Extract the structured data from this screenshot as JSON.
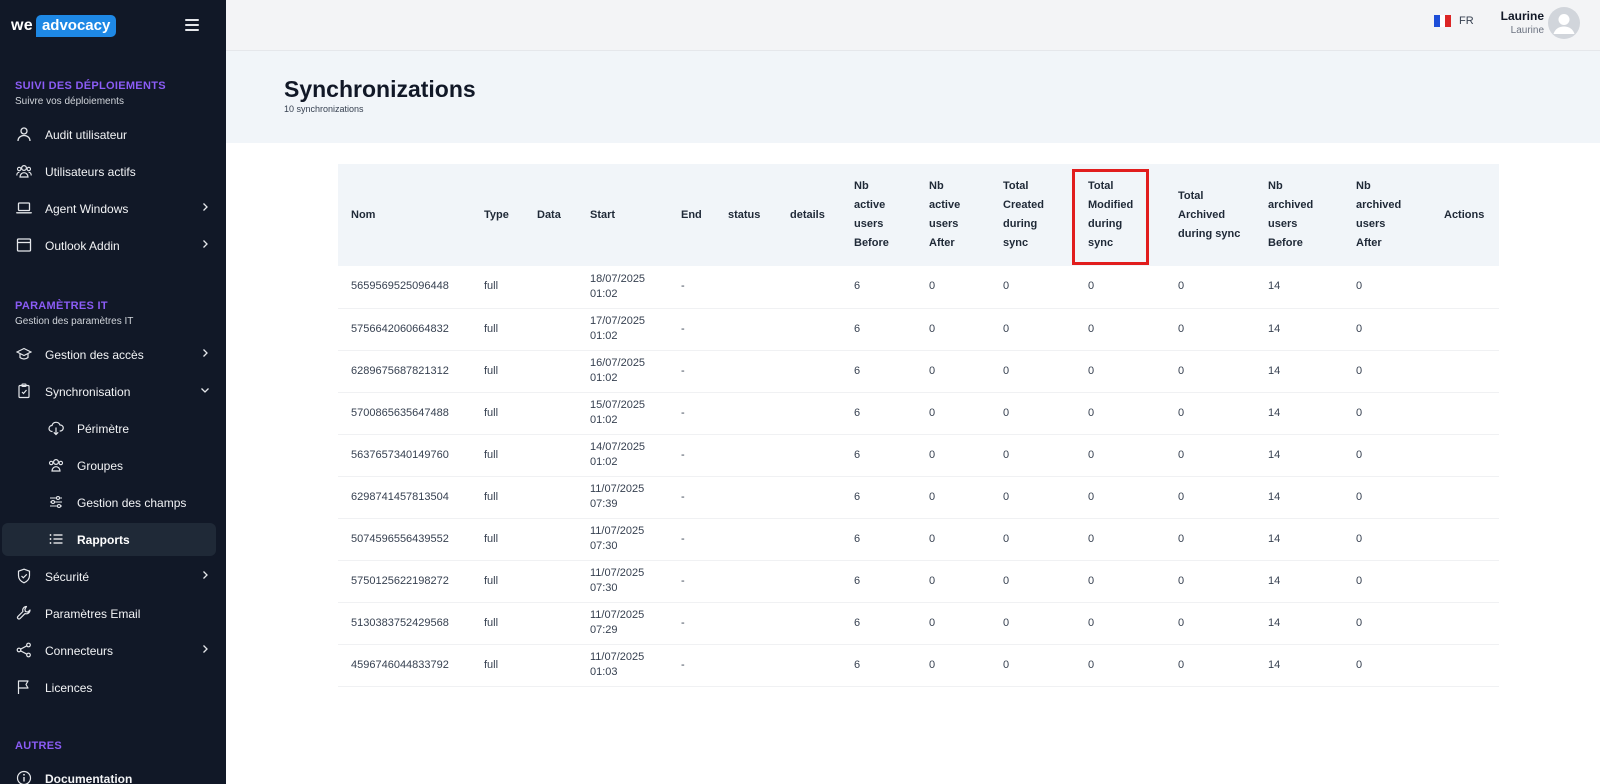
{
  "brand": {
    "we": "we",
    "advocacy": "advocacy"
  },
  "sidebar": {
    "sections": [
      {
        "title": "SUIVI DES DÉPLOIEMENTS",
        "subtitle": "Suivre vos déploiements"
      },
      {
        "title": "PARAMÈTRES IT",
        "subtitle": "Gestion des paramètres IT"
      },
      {
        "title": "AUTRES"
      }
    ],
    "items": [
      {
        "label": "Audit utilisateur",
        "icon": "user-icon"
      },
      {
        "label": "Utilisateurs actifs",
        "icon": "users-icon"
      },
      {
        "label": "Agent Windows",
        "icon": "laptop-icon"
      },
      {
        "label": "Outlook Addin",
        "icon": "window-icon"
      },
      {
        "label": "Gestion des accès",
        "icon": "graduation-cap-icon"
      },
      {
        "label": "Synchronisation",
        "icon": "sync-clipboard-icon"
      },
      {
        "label": "Périmètre",
        "icon": "cloud-download-icon"
      },
      {
        "label": "Groupes",
        "icon": "group-icon"
      },
      {
        "label": "Gestion des champs",
        "icon": "sliders-icon"
      },
      {
        "label": "Rapports",
        "icon": "list-icon"
      },
      {
        "label": "Sécurité",
        "icon": "shield-icon"
      },
      {
        "label": "Paramètres Email",
        "icon": "wrench-icon"
      },
      {
        "label": "Connecteurs",
        "icon": "share-icon"
      },
      {
        "label": "Licences",
        "icon": "flag-icon"
      },
      {
        "label": "Documentation",
        "icon": "info-icon"
      }
    ]
  },
  "header": {
    "language": "FR",
    "user_name": "Laurine",
    "user_sub": "Laurine"
  },
  "page": {
    "title": "Synchronizations",
    "count": "10 synchronizations"
  },
  "table": {
    "headers": [
      "Nom",
      "Type",
      "Data",
      "Start",
      "End",
      "status",
      "details",
      "Nb active users Before",
      "Nb active users After",
      "Total Created during sync",
      "Total Modified during sync",
      "Total Archived during sync",
      "Nb archived users Before",
      "Nb archived users After",
      "Actions"
    ],
    "rows": [
      {
        "nom": "5659569525096448",
        "type": "full",
        "start": "18/07/2025 01:02",
        "end": "-",
        "active_before": "6",
        "active_after": "0",
        "created": "0",
        "modified": "0",
        "archived": "0",
        "archived_before": "14",
        "archived_after": "0"
      },
      {
        "nom": "5756642060664832",
        "type": "full",
        "start": "17/07/2025 01:02",
        "end": "-",
        "active_before": "6",
        "active_after": "0",
        "created": "0",
        "modified": "0",
        "archived": "0",
        "archived_before": "14",
        "archived_after": "0"
      },
      {
        "nom": "6289675687821312",
        "type": "full",
        "start": "16/07/2025 01:02",
        "end": "-",
        "active_before": "6",
        "active_after": "0",
        "created": "0",
        "modified": "0",
        "archived": "0",
        "archived_before": "14",
        "archived_after": "0"
      },
      {
        "nom": "5700865635647488",
        "type": "full",
        "start": "15/07/2025 01:02",
        "end": "-",
        "active_before": "6",
        "active_after": "0",
        "created": "0",
        "modified": "0",
        "archived": "0",
        "archived_before": "14",
        "archived_after": "0"
      },
      {
        "nom": "5637657340149760",
        "type": "full",
        "start": "14/07/2025 01:02",
        "end": "-",
        "active_before": "6",
        "active_after": "0",
        "created": "0",
        "modified": "0",
        "archived": "0",
        "archived_before": "14",
        "archived_after": "0"
      },
      {
        "nom": "6298741457813504",
        "type": "full",
        "start": "11/07/2025 07:39",
        "end": "-",
        "active_before": "6",
        "active_after": "0",
        "created": "0",
        "modified": "0",
        "archived": "0",
        "archived_before": "14",
        "archived_after": "0"
      },
      {
        "nom": "5074596556439552",
        "type": "full",
        "start": "11/07/2025 07:30",
        "end": "-",
        "active_before": "6",
        "active_after": "0",
        "created": "0",
        "modified": "0",
        "archived": "0",
        "archived_before": "14",
        "archived_after": "0"
      },
      {
        "nom": "5750125622198272",
        "type": "full",
        "start": "11/07/2025 07:30",
        "end": "-",
        "active_before": "6",
        "active_after": "0",
        "created": "0",
        "modified": "0",
        "archived": "0",
        "archived_before": "14",
        "archived_after": "0"
      },
      {
        "nom": "5130383752429568",
        "type": "full",
        "start": "11/07/2025 07:29",
        "end": "-",
        "active_before": "6",
        "active_after": "0",
        "created": "0",
        "modified": "0",
        "archived": "0",
        "archived_before": "14",
        "archived_after": "0"
      },
      {
        "nom": "4596746044833792",
        "type": "full",
        "start": "11/07/2025 01:03",
        "end": "-",
        "active_before": "6",
        "active_after": "0",
        "created": "0",
        "modified": "0",
        "archived": "0",
        "archived_before": "14",
        "archived_after": "0"
      }
    ]
  },
  "colors": {
    "sidebar_bg": "#111827",
    "section_title": "#8b5cf6",
    "brand_blue": "#1e88e5",
    "highlight": "#e11d1d"
  }
}
